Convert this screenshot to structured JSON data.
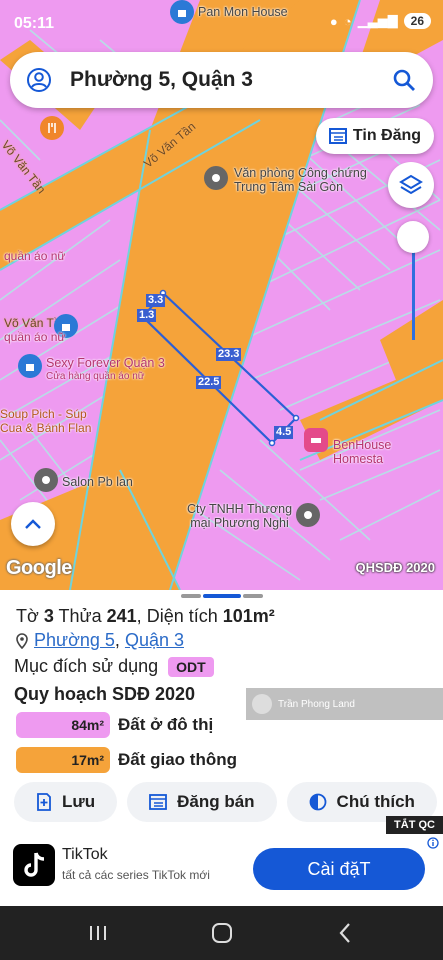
{
  "status_bar": {
    "time": "05:11",
    "battery": "26"
  },
  "search": {
    "title": "Phường 5, Quận 3"
  },
  "map": {
    "tin_dang_label": "Tin Đăng",
    "brand": "Google",
    "layer_label": "QHSDĐ 2020",
    "streets": [
      "Võ Văn Tần",
      "Võ Văn Tần",
      "Võ Văn Tần"
    ],
    "pois": {
      "pan_mon": "Pan Mon House",
      "van_phong": [
        "Văn phòng Công chứng",
        "Trung Tâm Sài Gòn"
      ],
      "quan_ao_1": "quần áo nữ",
      "quan_ao_2": "quần áo nữ",
      "sexy": "Sexy Forever Quận 3",
      "cua_hang": "Cửa hàng quần áo nữ",
      "soup": [
        "Soup Pich - Súp",
        "Cua & Bánh Flan"
      ],
      "benhouse": "BenHouse Homesta",
      "salon": "Salon Pb lan",
      "cty": [
        "Cty TNHH Thương",
        "mại Phương Nghi"
      ]
    },
    "dimensions": [
      "3.3",
      "1.3",
      "23.3",
      "22.5",
      "4.5"
    ]
  },
  "sheet": {
    "to_label": "Tờ",
    "to_value": "3",
    "thua_label": "Thửa",
    "thua_value": "241",
    "dien_tich_label": "Diện tích",
    "dien_tich_value": "101m²",
    "ward": "Phường 5",
    "sep": ",",
    "district": "Quận 3",
    "muc_dich_label": "Mục đích sử dụng",
    "muc_dich_code": "ODT",
    "quy_hoach_title": "Quy hoạch SDĐ 2020",
    "legend": [
      {
        "area": "84m²",
        "label": "Đất ở đô thị",
        "color": "#ee9af0"
      },
      {
        "area": "17m²",
        "label": "Đất giao thông",
        "color": "#f5a33a"
      }
    ],
    "watermark": "Trần Phong Land",
    "buttons": {
      "save": "Lưu",
      "post": "Đăng bán",
      "note": "Chú thích"
    }
  },
  "ad": {
    "badge": "TẮT QC",
    "title": "TikTok",
    "subtitle": "tất cả các series TikTok mới",
    "install": "Cài đặT"
  },
  "colors": {
    "residential": "#ee9af0",
    "road": "#f5a33a",
    "accent": "#1558d6"
  }
}
